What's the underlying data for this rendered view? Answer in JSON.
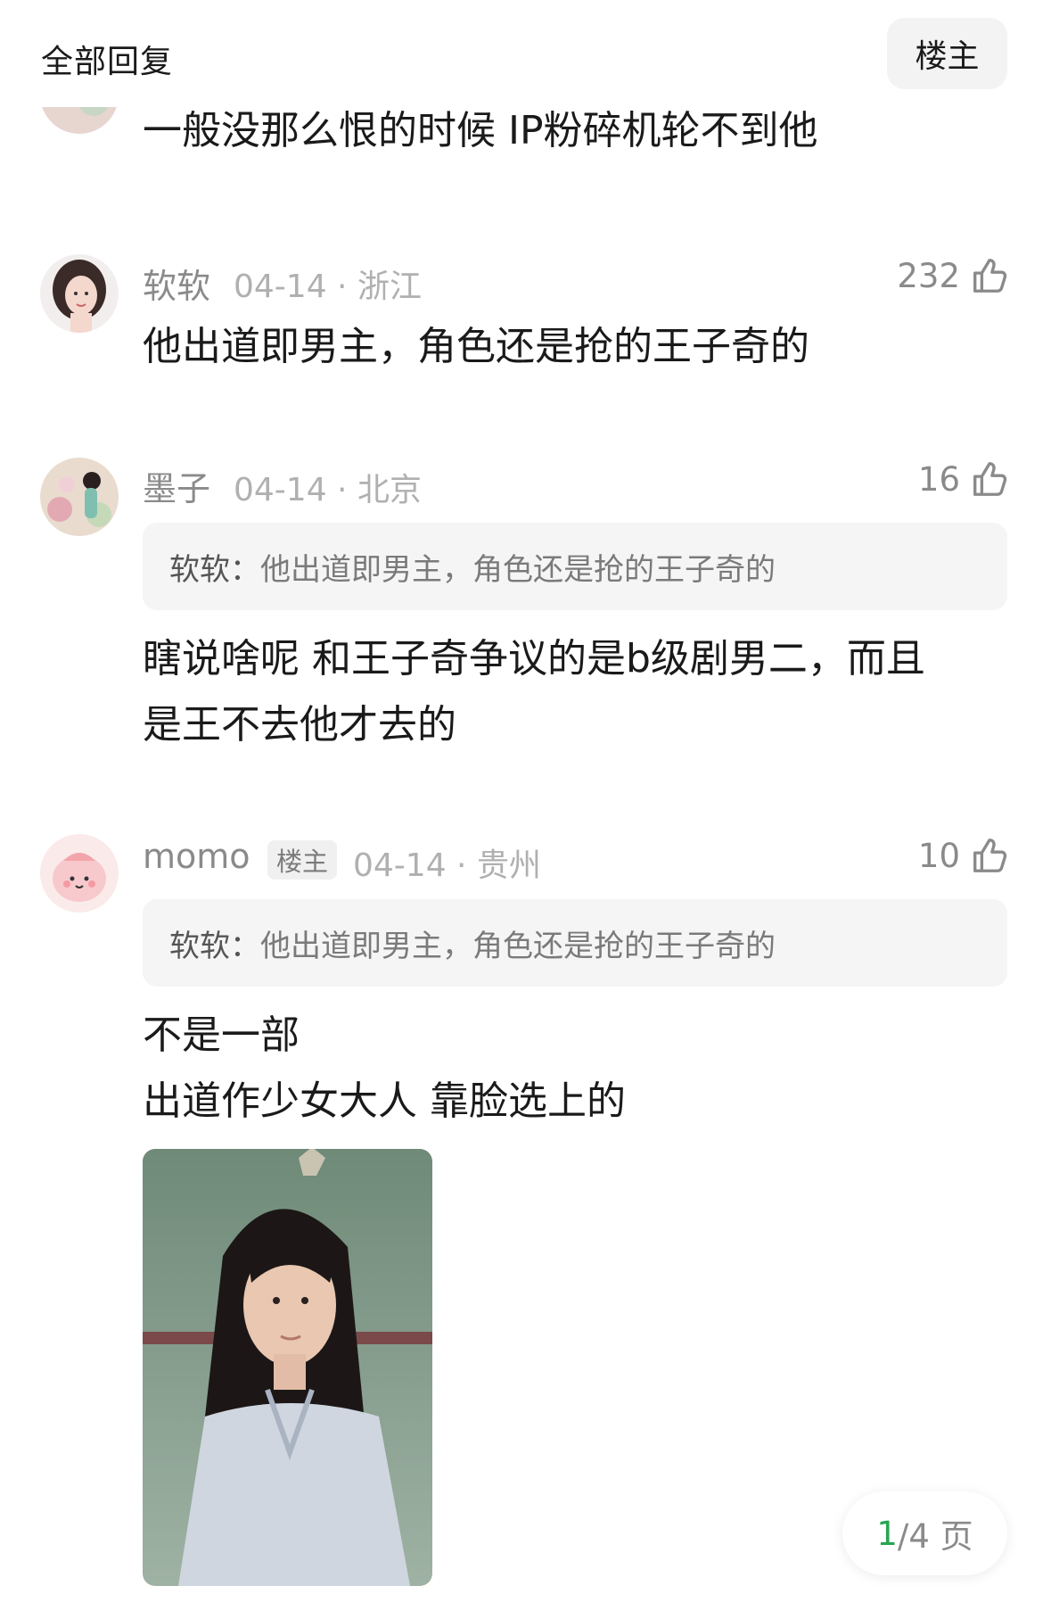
{
  "header": {
    "title": "全部回复",
    "filter_button": "楼主"
  },
  "comments": [
    {
      "body": [
        "一般没那么恨的时候 IP粉碎机轮不到他"
      ]
    },
    {
      "user": "软软",
      "meta": "04-14 · 浙江",
      "likes": "232",
      "body": [
        "他出道即男主，角色还是抢的王子奇的"
      ]
    },
    {
      "user": "墨子",
      "meta": "04-14 · 北京",
      "likes": "16",
      "quote": {
        "author": "软软：",
        "text": "他出道即男主，角色还是抢的王子奇的"
      },
      "body": [
        "瞎说啥呢 和王子奇争议的是b级剧男二，而且",
        "是王不去他才去的"
      ]
    },
    {
      "user": "momo",
      "badge": "楼主",
      "meta": "04-14 · 贵州",
      "likes": "10",
      "quote": {
        "author": "软软：",
        "text": "他出道即男主，角色还是抢的王子奇的"
      },
      "body": [
        "不是一部",
        "出道作少女大人 靠脸选上的"
      ]
    }
  ],
  "pager": {
    "current": "1",
    "total": "/4 页"
  },
  "colors": {
    "accent_green": "#2aa553",
    "meta_grey": "#b0b0b0",
    "quote_bg": "#f5f5f5"
  },
  "icons": {
    "like": "thumbs-up-icon"
  }
}
